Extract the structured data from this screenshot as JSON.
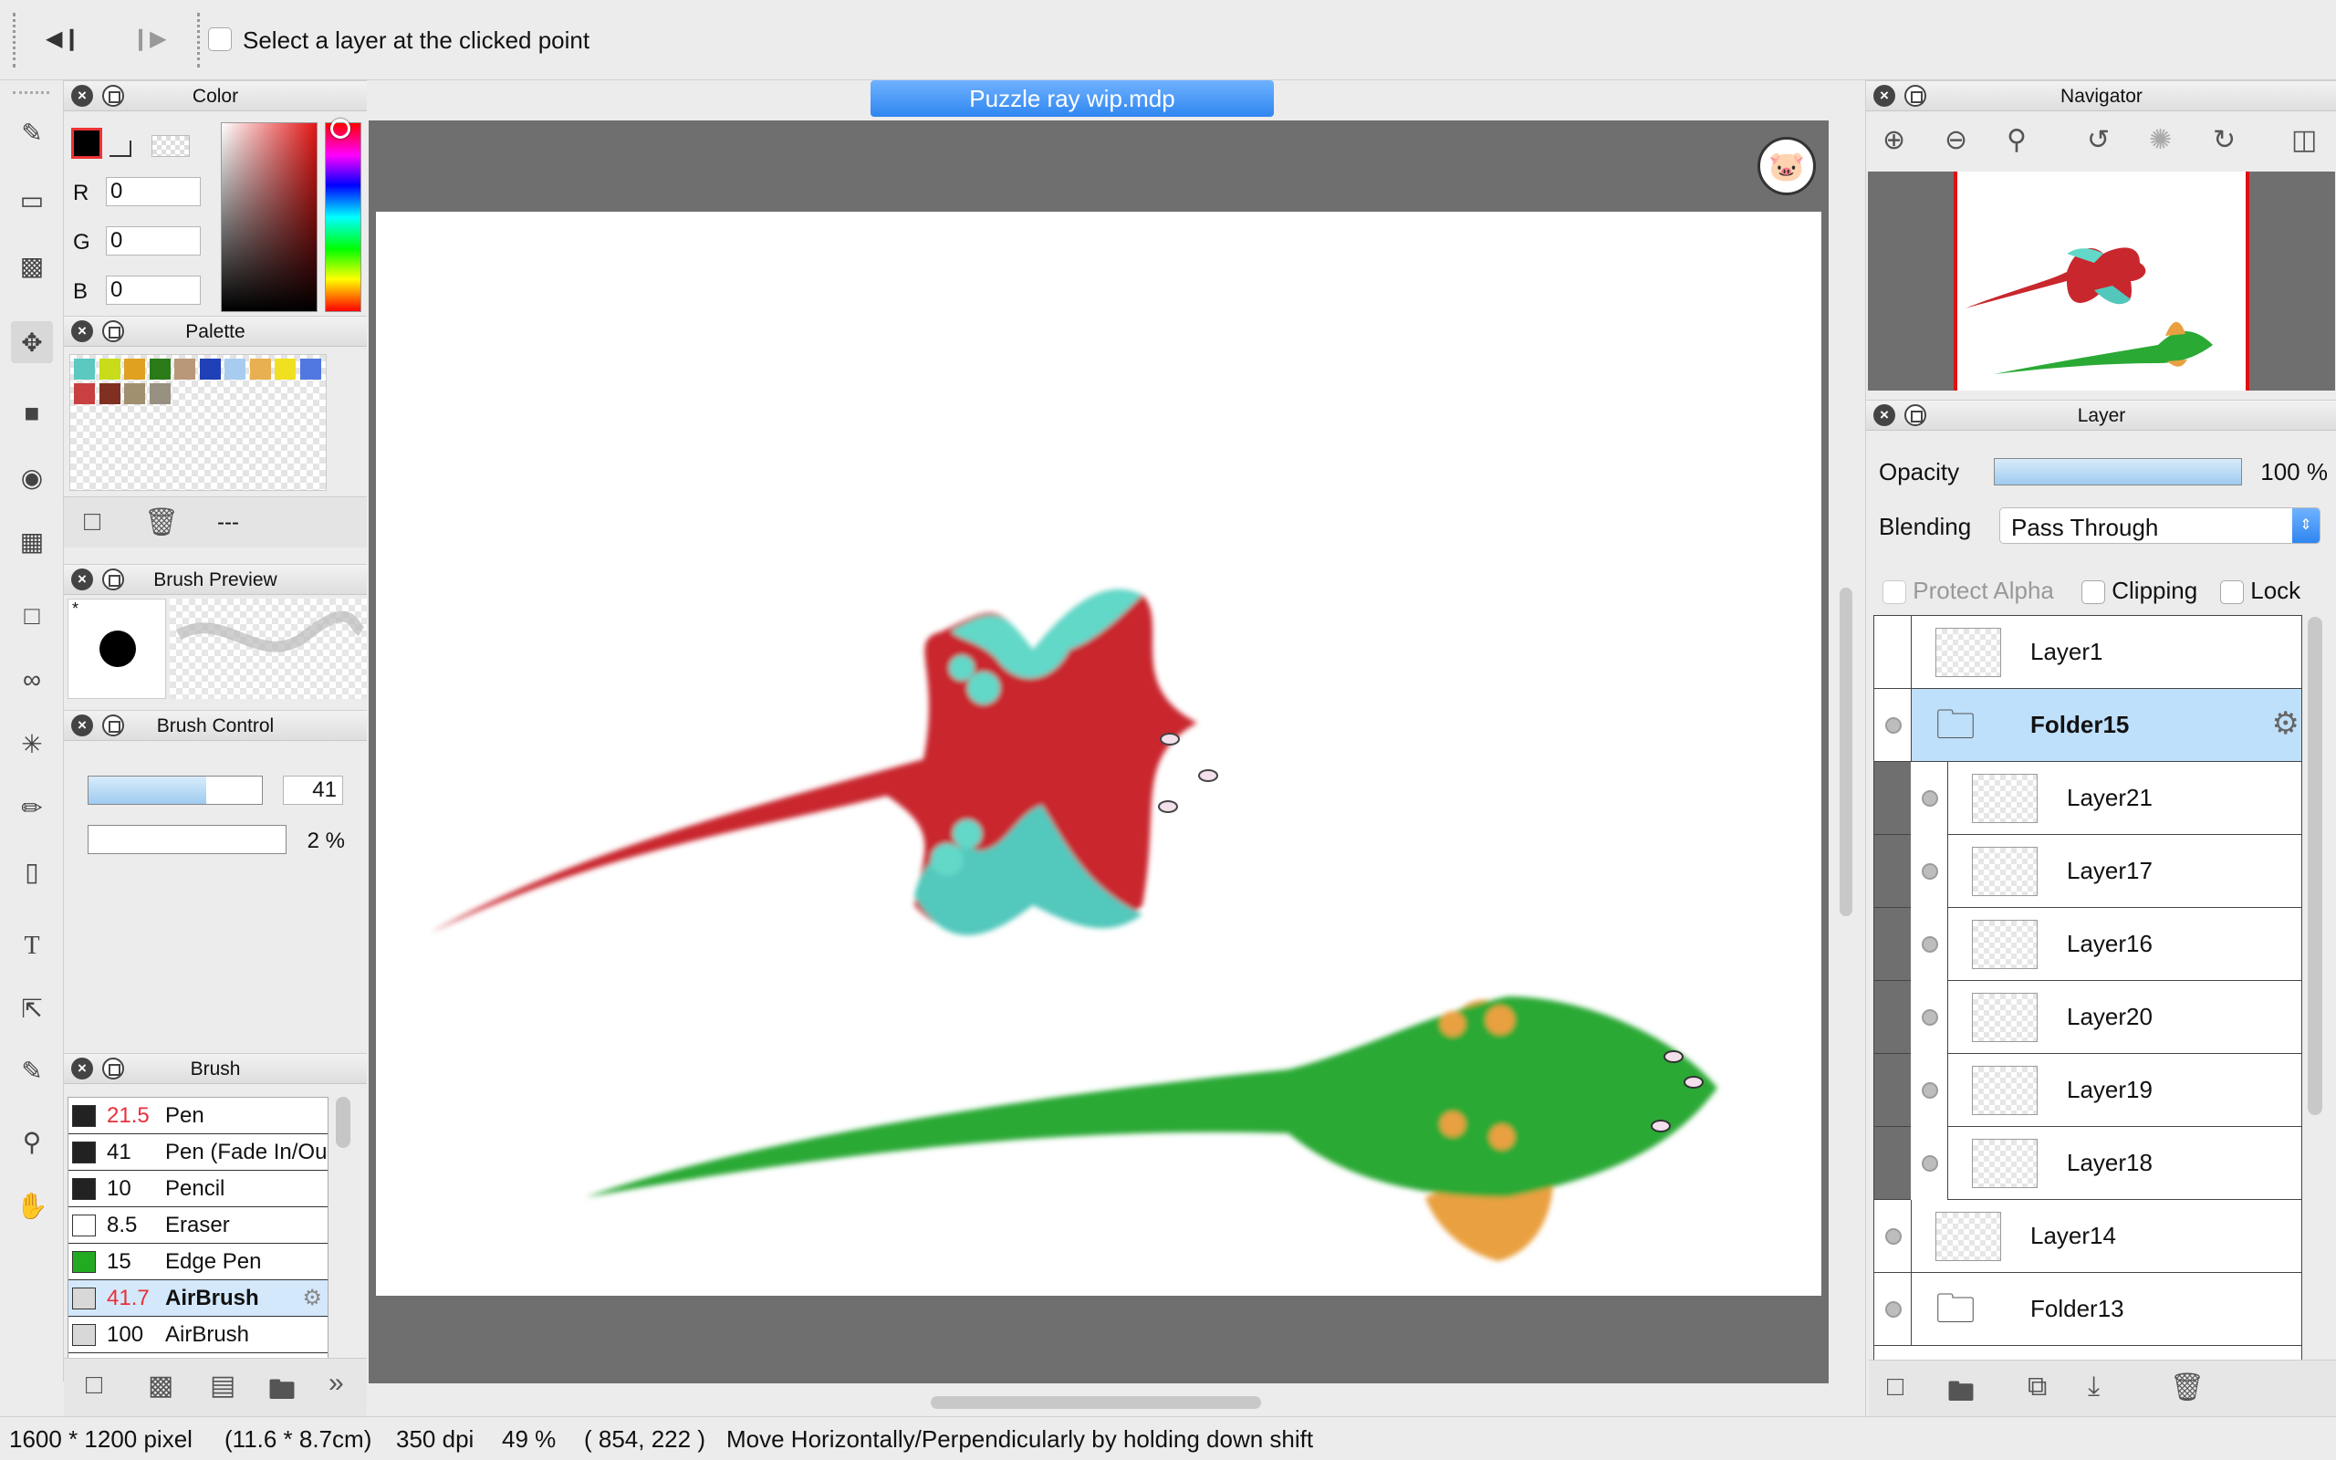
{
  "topbar": {
    "select_layer_label": "Select a layer at the clicked point"
  },
  "color_panel": {
    "title": "Color",
    "r_label": "R",
    "g_label": "G",
    "b_label": "B",
    "r": "0",
    "g": "0",
    "b": "0"
  },
  "palette_panel": {
    "title": "Palette",
    "page_label": "---",
    "colors": [
      "#5cc8c0",
      "#c8dc1a",
      "#e0a020",
      "#2a7a18",
      "#b89878",
      "#2040b8",
      "#a8ccf0",
      "#e8b050",
      "#f0e020",
      "#5078e0",
      "#c84040",
      "#803020",
      "#a09070",
      "#989080"
    ]
  },
  "brush_preview": {
    "title": "Brush Preview",
    "marker": "*"
  },
  "brush_control": {
    "title": "Brush Control",
    "size": "41",
    "opacity": "2 %",
    "size_fraction": 0.68,
    "opacity_fraction": 0.0
  },
  "brush_panel": {
    "title": "Brush",
    "items": [
      {
        "size": "21.5",
        "name": "Pen",
        "color": "#222222",
        "size_red": true
      },
      {
        "size": "41",
        "name": "Pen (Fade In/Ou",
        "color": "#222222",
        "size_red": false
      },
      {
        "size": "10",
        "name": "Pencil",
        "color": "#222222",
        "size_red": false
      },
      {
        "size": "8.5",
        "name": "Eraser",
        "color": "#ffffff",
        "size_red": false
      },
      {
        "size": "15",
        "name": "Edge Pen",
        "color": "#22aa22",
        "size_red": false
      },
      {
        "size": "41.7",
        "name": "AirBrush",
        "color": "#d8d8d8",
        "size_red": true
      },
      {
        "size": "100",
        "name": "AirBrush",
        "color": "#d8d8d8",
        "size_red": false
      }
    ]
  },
  "document": {
    "tab_title": "Puzzle ray wip.mdp"
  },
  "navigator": {
    "title": "Navigator"
  },
  "layer_panel": {
    "title": "Layer",
    "opacity_label": "Opacity",
    "opacity_value": "100 %",
    "opacity_fraction": 1.0,
    "blending_label": "Blending",
    "blending_value": "Pass Through",
    "protect_alpha": "Protect Alpha",
    "clipping": "Clipping",
    "lock": "Lock",
    "layers": [
      {
        "name": "Layer1"
      },
      {
        "name": "Folder15"
      },
      {
        "name": "Layer21"
      },
      {
        "name": "Layer17"
      },
      {
        "name": "Layer16"
      },
      {
        "name": "Layer20"
      },
      {
        "name": "Layer19"
      },
      {
        "name": "Layer18"
      },
      {
        "name": "Layer14"
      },
      {
        "name": "Folder13"
      }
    ]
  },
  "statusbar": {
    "size": "1600 * 1200 pixel",
    "dimensions": "(11.6 * 8.7cm)",
    "dpi": "350 dpi",
    "zoom": "49 %",
    "coords": "( 854, 222 )",
    "hint": "Move Horizontally/Perpendicularly by holding down shift"
  }
}
